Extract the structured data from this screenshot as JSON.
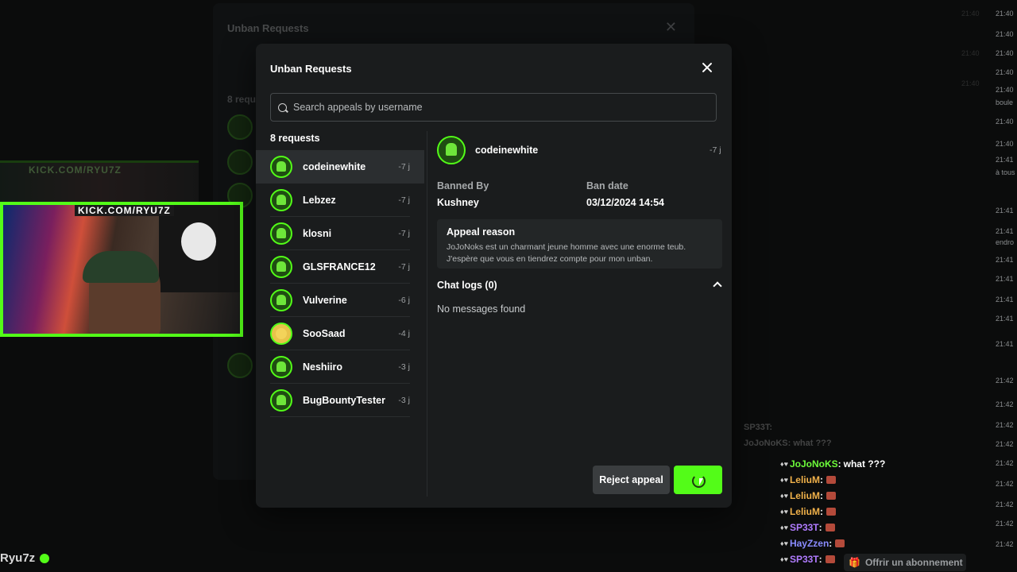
{
  "background": {
    "ghost_title": "Unban Requests",
    "ghost_count": "8 requ",
    "stream_label_1": "KICK.COM/RYU7Z",
    "stream_label_2": "KICK.COM/RYU7Z",
    "streamer_name": "Ryu7z",
    "subscribe_label": "Offrir un abonnement",
    "timestamps": [
      "21:40",
      "21:40",
      "21:40",
      "21:40",
      "21:40",
      "21:40",
      "21:40",
      "21:41",
      "21:41",
      "21:41",
      "21:41",
      "21:41",
      "21:41",
      "21:41",
      "21:41",
      "21:42",
      "21:42",
      "21:42",
      "21:42",
      "21:42",
      "21:42",
      "21:42",
      "21:42",
      "21:42"
    ],
    "side_text": [
      "boule",
      "à tous",
      "endro"
    ]
  },
  "chat": {
    "lines": [
      {
        "user": "JoJoNoKS",
        "color": "#6dfc3a",
        "message": "what ???"
      },
      {
        "user": "LeliuM",
        "color": "#f0b14a",
        "message": ""
      },
      {
        "user": "LeliuM",
        "color": "#f0b14a",
        "message": ""
      },
      {
        "user": "LeliuM",
        "color": "#f0b14a",
        "message": ""
      },
      {
        "user": "SP33T",
        "color": "#b07cff",
        "message": ""
      },
      {
        "user": "HayZzen",
        "color": "#8a8cff",
        "message": ""
      },
      {
        "user": "SP33T",
        "color": "#b07cff",
        "message": ""
      }
    ],
    "ghost_lines": [
      "SP33T:",
      "JoJoNoKS: what ???"
    ]
  },
  "modal": {
    "title": "Unban Requests",
    "search_placeholder": "Search appeals by username",
    "request_count": "8 requests",
    "requests": [
      {
        "username": "codeinewhite",
        "ago": "-7 j"
      },
      {
        "username": "Lebzez",
        "ago": "-7 j"
      },
      {
        "username": "klosni",
        "ago": "-7 j"
      },
      {
        "username": "GLSFRANCE12",
        "ago": "-7 j"
      },
      {
        "username": "Vulverine",
        "ago": "-6 j"
      },
      {
        "username": "SooSaad",
        "ago": "-4 j"
      },
      {
        "username": "Neshiiro",
        "ago": "-3 j"
      },
      {
        "username": "BugBountyTester",
        "ago": "-3 j"
      }
    ],
    "selected": {
      "username": "codeinewhite",
      "ago": "-7 j",
      "banned_by_label": "Banned By",
      "banned_by": "Kushney",
      "ban_date_label": "Ban date",
      "ban_date": "03/12/2024 14:54",
      "appeal_reason_label": "Appeal reason",
      "appeal_reason": "JoJoNoks est un charmant jeune homme avec une enorme teub. J'espère que vous en tiendrez compte pour mon unban.",
      "chat_logs_label": "Chat logs (0)",
      "no_messages": "No messages found"
    },
    "reject_label": "Reject appeal",
    "accent_color": "#53fc18"
  }
}
